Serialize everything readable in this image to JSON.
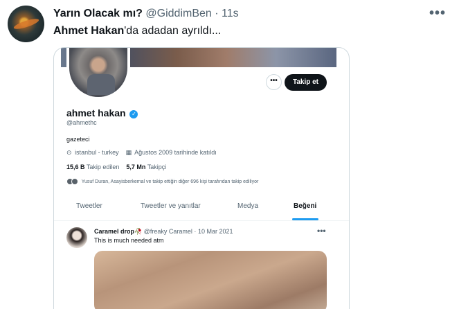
{
  "tweet": {
    "author": "Yarın Olacak mı?",
    "handle": "@GiddimBen",
    "separator": "·",
    "time": "11s",
    "more": "•••",
    "text_bold": "Ahmet Hakan",
    "text_rest": "'da adadan ayrıldı..."
  },
  "embedded_profile": {
    "more": "•••",
    "follow_label": "Takip et",
    "name": "ahmet hakan",
    "verified": "✓",
    "handle": "@ahmethc",
    "bio": "gazeteci",
    "location_icon": "⊙",
    "location": "istanbul - turkey",
    "joined_icon": "▦",
    "joined": "Ağustos 2009 tarihinde katıldı",
    "following_count": "15,6 B",
    "following_label": "Takip edilen",
    "followers_count": "5,7 Mn",
    "followers_label": "Takipçi",
    "followed_by": "Yusuf Duran, Asayisberkemal ve takip ettiğin diğer 696 kişi tarafından takip ediliyor",
    "tabs": [
      {
        "label": "Tweetler",
        "active": false
      },
      {
        "label": "Tweetler ve yanıtlar",
        "active": false
      },
      {
        "label": "Medya",
        "active": false
      },
      {
        "label": "Beğeni",
        "active": true
      }
    ],
    "accent": "#1d9bf0"
  },
  "inner_tweet": {
    "name": "Caramel drop🥀",
    "handle": "@freaky Caramel",
    "separator": "·",
    "date": "10 Mar 2021",
    "more": "•••",
    "text": "This is much needed atm"
  }
}
